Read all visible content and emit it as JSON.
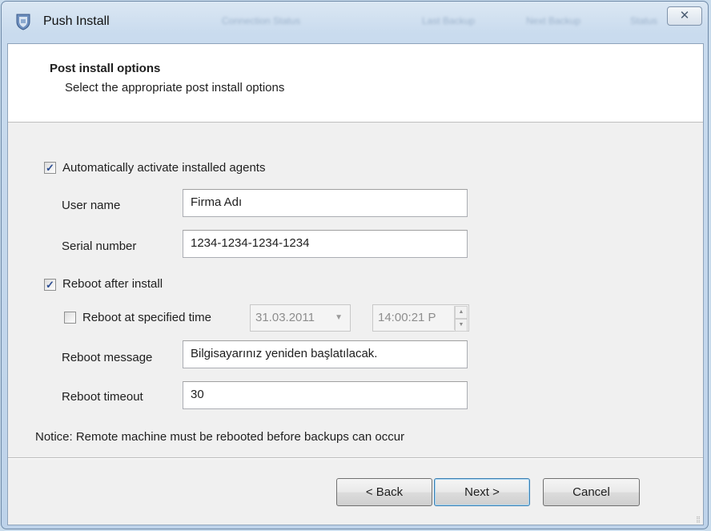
{
  "window": {
    "title": "Push Install",
    "close_glyph": "✕",
    "background_columns": [
      "Connection Status",
      "Last Backup",
      "Next Backup",
      "Status"
    ]
  },
  "header": {
    "title": "Post install options",
    "subtitle": "Select the appropriate post install options"
  },
  "options": {
    "auto_activate": {
      "label": "Automatically activate installed agents",
      "checked": true
    },
    "user_name": {
      "label": "User name",
      "value": "Firma Adı"
    },
    "serial_number": {
      "label": "Serial number",
      "value": "1234-1234-1234-1234"
    },
    "reboot_after_install": {
      "label": "Reboot after install",
      "checked": true
    },
    "reboot_at_time": {
      "label": "Reboot at specified time",
      "checked": false,
      "date": "31.03.2011",
      "time": "14:00:21 P"
    },
    "reboot_message": {
      "label": "Reboot message",
      "value": "Bilgisayarınız yeniden başlatılacak."
    },
    "reboot_timeout": {
      "label": "Reboot timeout",
      "value": "30"
    }
  },
  "notice": "Notice: Remote machine must be rebooted before backups can occur",
  "buttons": {
    "back": "< Back",
    "next": "Next >",
    "cancel": "Cancel"
  },
  "icons": {
    "app": "shield-install-icon",
    "check": "✓",
    "dropdown": "▼",
    "spin_up": "▲",
    "spin_down": "▼",
    "grip": "⣿"
  },
  "colors": {
    "checkmark": "#2b4d92",
    "default_button_border": "#3c7fb1",
    "window_frame": "#c9dbee"
  }
}
